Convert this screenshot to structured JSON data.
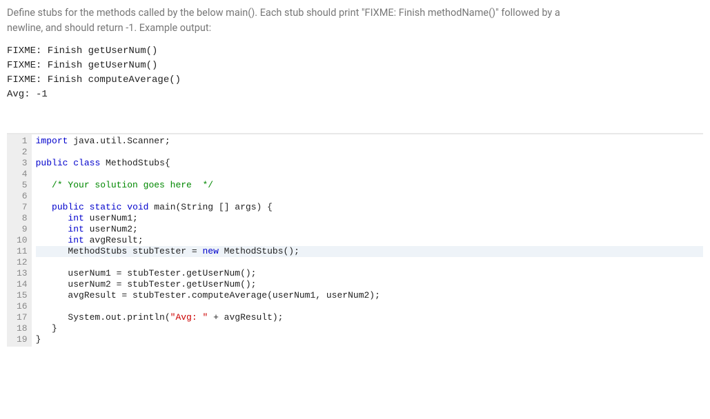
{
  "question": {
    "prompt_line1": "Define stubs for the methods called by the below main(). Each stub should print \"FIXME: Finish methodName()\" followed by a",
    "prompt_line2": "newline, and should return -1. Example output:"
  },
  "example_output": "FIXME: Finish getUserNum()\nFIXME: Finish getUserNum()\nFIXME: Finish computeAverage()\nAvg: -1",
  "code": {
    "line_numbers": [
      "1",
      "2",
      "3",
      "4",
      "5",
      "6",
      "7",
      "8",
      "9",
      "10",
      "11",
      "12",
      "13",
      "14",
      "15",
      "16",
      "17",
      "18",
      "19"
    ],
    "l1_kw1": "import",
    "l1_rest": " java.util.Scanner;",
    "l3_kw1": "public",
    "l3_kw2": "class",
    "l3_rest": " MethodStubs{",
    "l5_comment": "/* Your solution goes here  */",
    "l7_kw1": "public",
    "l7_kw2": "static",
    "l7_kw3": "void",
    "l7_rest": " main(String [] args) {",
    "l8_kw": "int",
    "l8_rest": " userNum1;",
    "l9_kw": "int",
    "l9_rest": " userNum2;",
    "l10_kw": "int",
    "l10_rest": " avgResult;",
    "l11_a": "MethodStubs stubTester = ",
    "l11_kw": "new",
    "l11_b": " MethodStubs();",
    "l13": "userNum1 = stubTester.getUserNum();",
    "l14": "userNum2 = stubTester.getUserNum();",
    "l15": "avgResult = stubTester.computeAverage(userNum1, userNum2);",
    "l17_a": "System.out.println(",
    "l17_str": "\"Avg: \"",
    "l17_b": " + avgResult);",
    "l18": "}",
    "l19": "}"
  }
}
